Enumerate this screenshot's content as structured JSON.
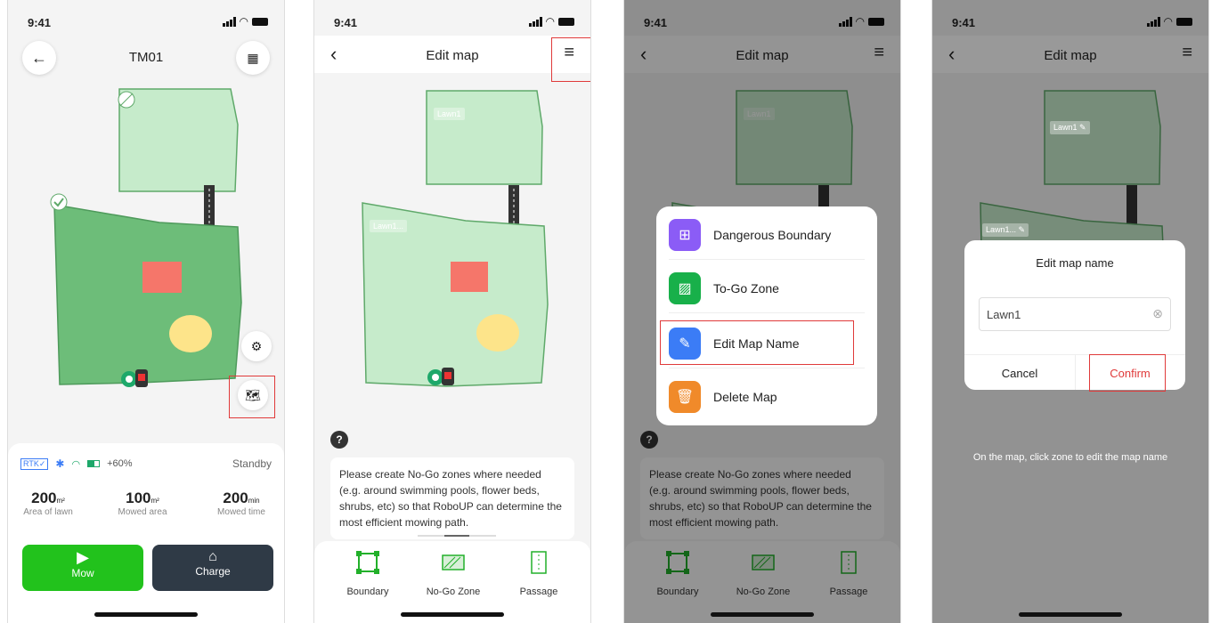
{
  "status": {
    "time": "9:41"
  },
  "phone1": {
    "title": "TM01",
    "back_icon": "arrow-left-icon",
    "grid_icon": "grid-icon",
    "rtk_label": "RTK✓",
    "battery_text": "+60%",
    "state": "Standby",
    "stats": [
      {
        "value": "200",
        "unit": "m²",
        "label": "Area of lawn"
      },
      {
        "value": "100",
        "unit": "m²",
        "label": "Mowed area"
      },
      {
        "value": "200",
        "unit": "min",
        "label": "Mowed time"
      }
    ],
    "mow_label": "Mow",
    "charge_label": "Charge",
    "colors": {
      "mow": "#22c21c",
      "charge": "#2f3a46",
      "lawn_dark": "#6dbd79",
      "lawn_light": "#c6ebcb",
      "no_go": "#f5766a",
      "spot": "#fde48a"
    }
  },
  "editor": {
    "title": "Edit map",
    "lawn1_chip": "Lawn1",
    "lawn2_chip": "Lawn1...",
    "help_icon": "?",
    "hint": "Please create No-Go zones where needed (e.g. around swimming pools, flower beds, shrubs, etc) so that  RoboUP can determine the most efficient mowing path.",
    "tools": [
      {
        "label": "Boundary",
        "icon": "boundary-icon"
      },
      {
        "label": "No-Go Zone",
        "icon": "no-go-zone-icon"
      },
      {
        "label": "Passage",
        "icon": "passage-icon"
      }
    ]
  },
  "menu": {
    "items": [
      {
        "label": "Dangerous Boundary",
        "icon": "plus-square-icon",
        "color": "#8b5cf6"
      },
      {
        "label": "To-Go Zone",
        "icon": "hatch-icon",
        "color": "#18b04a"
      },
      {
        "label": "Edit Map Name",
        "icon": "edit-icon",
        "color": "#3b7cf6"
      },
      {
        "label": "Delete Map",
        "icon": "trash-icon",
        "color": "#f08a2a"
      }
    ]
  },
  "rename": {
    "lawn1_chip": "Lawn1",
    "lawn2_chip": "Lawn1...",
    "dialog_title": "Edit map name",
    "input_value": "Lawn1",
    "cancel": "Cancel",
    "confirm": "Confirm",
    "hint": "On the map, click zone to edit the map name"
  }
}
